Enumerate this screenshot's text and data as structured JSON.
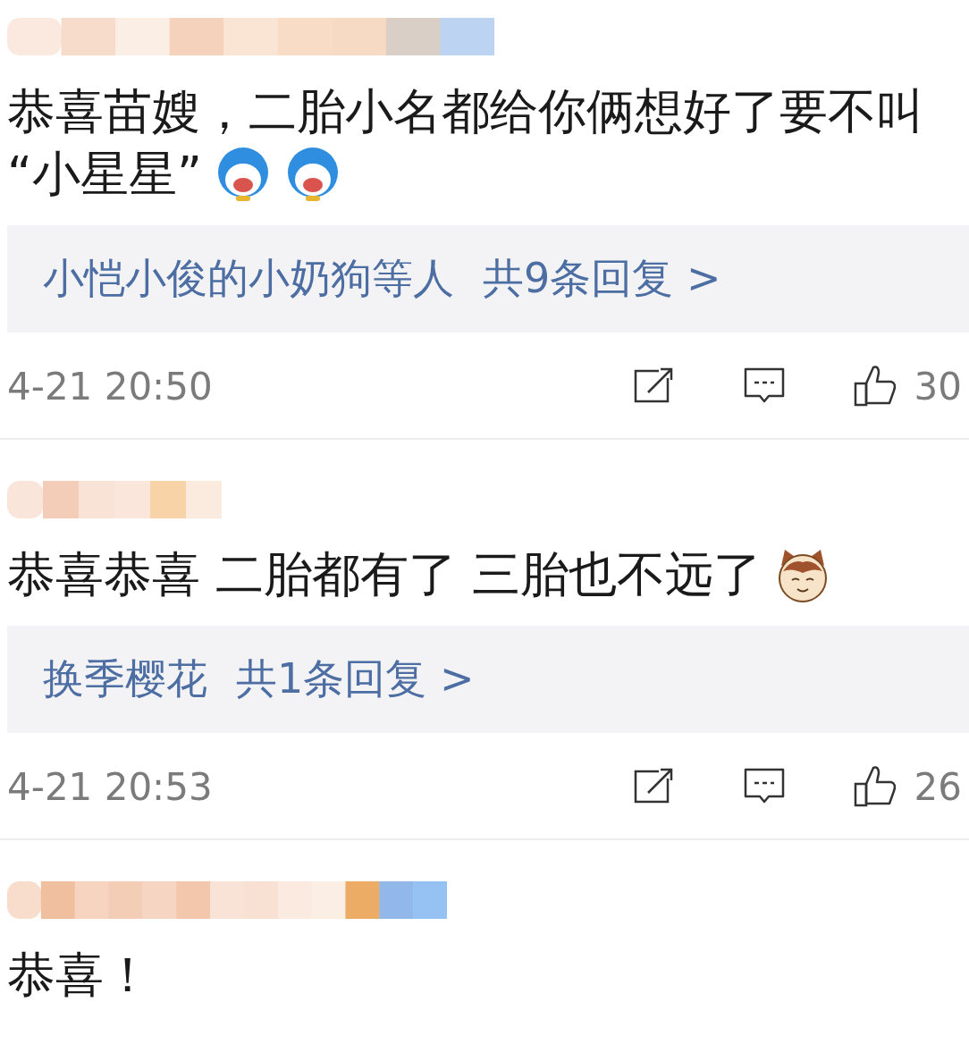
{
  "comments": [
    {
      "lines": [
        "恭喜苗嫂，二胎小名都给你俩想好了要不叫",
        "“小星星”"
      ],
      "emojis": [
        {
          "kind": "blue-face"
        },
        {
          "kind": "blue-face"
        }
      ],
      "replies": {
        "authors": "小恺小俊的小奶狗等人",
        "count": "共9条回复 >"
      },
      "time": "4-21 20:50",
      "likes": "30"
    },
    {
      "lines": [
        "恭喜恭喜 二胎都有了 三胎也不远了"
      ],
      "emojis": [
        {
          "kind": "cat-face"
        }
      ],
      "replies": {
        "authors": "换季樱花",
        "count": "共1条回复 >"
      },
      "time": "4-21 20:53",
      "likes": "26"
    },
    {
      "lines": [
        "恭喜！"
      ]
    }
  ]
}
